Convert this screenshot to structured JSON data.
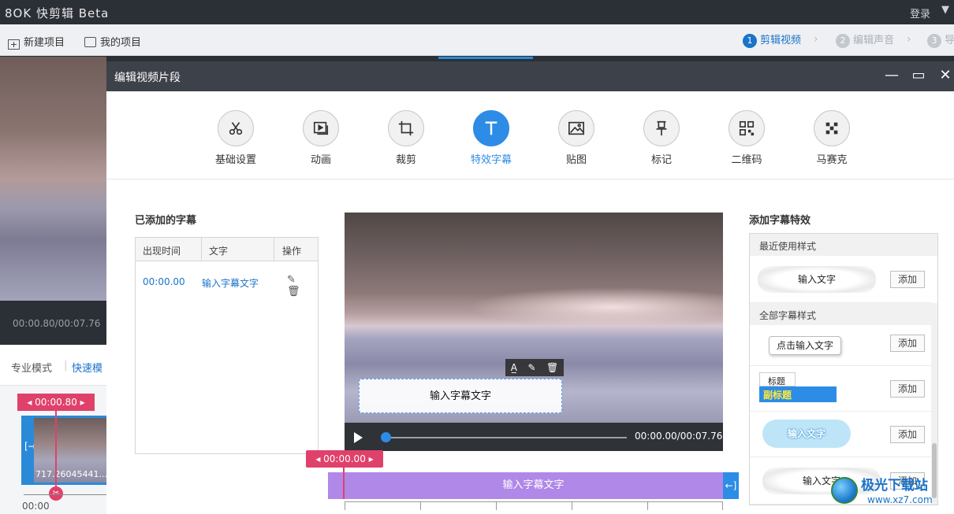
{
  "app": {
    "logo": "8OK 快剪辑 Beta",
    "login": "登录",
    "caret": "▼"
  },
  "toolbar": {
    "new_project": "新建项目",
    "my_projects": "我的项目",
    "steps": [
      {
        "num": "1",
        "label": "剪辑视频",
        "active": true
      },
      {
        "num": "2",
        "label": "编辑声音",
        "active": false
      },
      {
        "num": "3",
        "label": "导",
        "active": false
      }
    ]
  },
  "background": {
    "time": "00:00.80/00:07.76",
    "mode_pro": "专业模式",
    "mode_fast": "快速模",
    "tag_time": "00:00.80",
    "clip_label": "717.26045441...",
    "zero": "00:00"
  },
  "modal": {
    "title": "编辑视频片段",
    "tabs": [
      {
        "label": "基础设置",
        "icon": "scissors-icon"
      },
      {
        "label": "动画",
        "icon": "animation-icon"
      },
      {
        "label": "裁剪",
        "icon": "crop-icon"
      },
      {
        "label": "特效字幕",
        "icon": "text-icon"
      },
      {
        "label": "贴图",
        "icon": "image-icon"
      },
      {
        "label": "标记",
        "icon": "pin-icon"
      },
      {
        "label": "二维码",
        "icon": "qrcode-icon"
      },
      {
        "label": "马赛克",
        "icon": "mosaic-icon"
      }
    ],
    "active_tab": "特效字幕"
  },
  "subtitles": {
    "title": "已添加的字幕",
    "columns": [
      "出现时间",
      "文字",
      "操作"
    ],
    "rows": [
      {
        "time": "00:00.00",
        "text": "输入字幕文字"
      }
    ]
  },
  "video": {
    "caption": "输入字幕文字",
    "time": "00:00.00/00:07.76",
    "progress": 0.0
  },
  "timeline": {
    "tag_time": "00:00.00",
    "bar_label": "输入字幕文字"
  },
  "effects": {
    "title": "添加字幕特效",
    "recent_label": "最近使用样式",
    "all_label": "全部字幕样式",
    "add_label": "添加",
    "recent": [
      {
        "text": "输入文字"
      }
    ],
    "styles": [
      {
        "text": "点击输入文字"
      },
      {
        "title": "标题",
        "subtitle": "副标题"
      },
      {
        "text": "输入文字"
      },
      {
        "text": "输入文字"
      }
    ]
  },
  "watermark": {
    "name": "极光下载站",
    "url": "www.xz7.com"
  },
  "colors": {
    "accent": "#2d8ce5",
    "playhead": "#e0416b",
    "caption_track": "#b088e8",
    "header_bg": "#3d4149"
  }
}
